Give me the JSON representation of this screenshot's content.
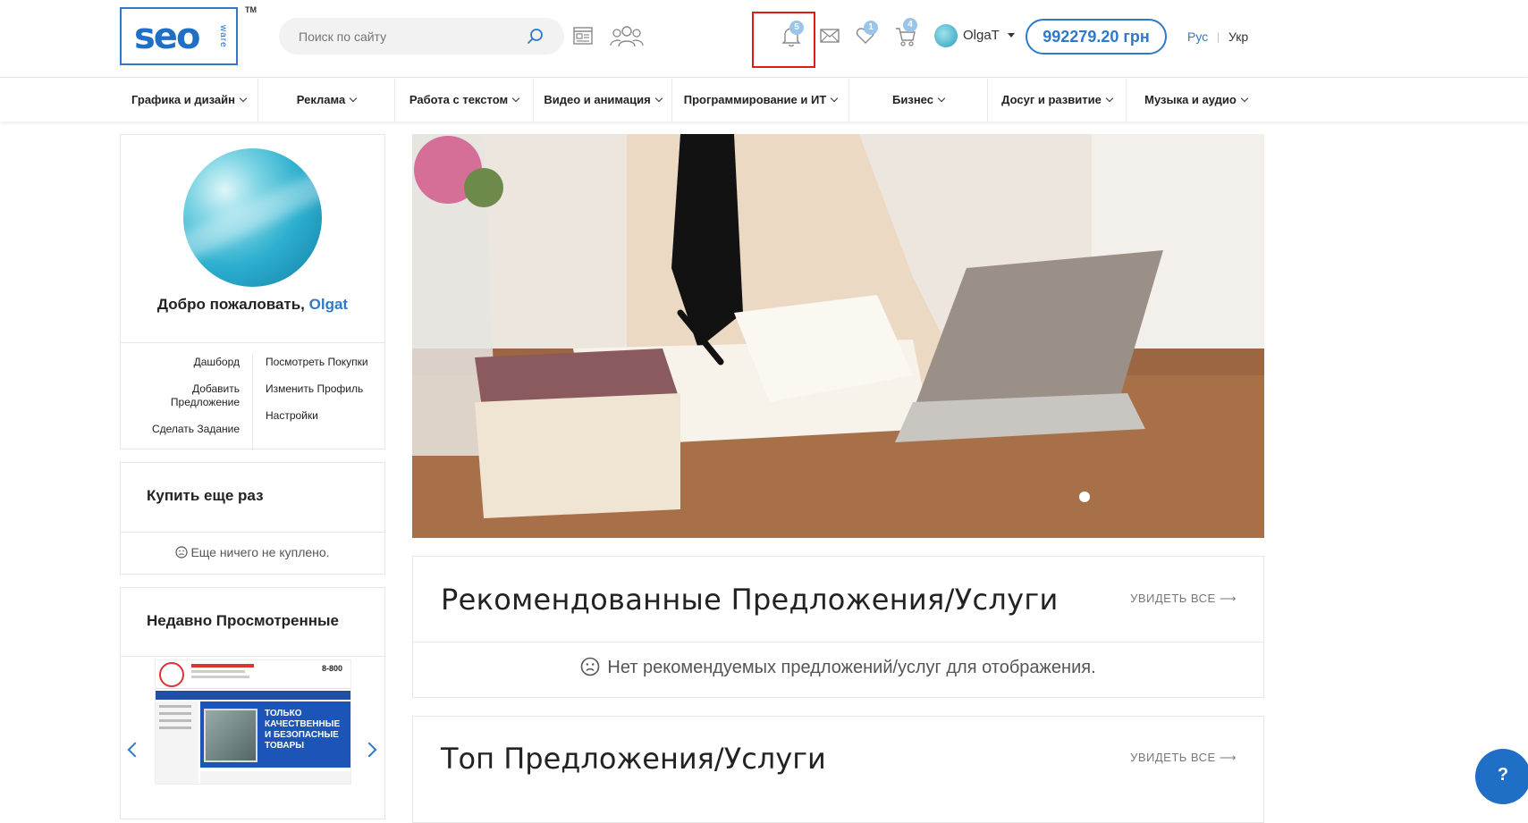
{
  "header": {
    "logo_text": "seo",
    "logo_sub": "ware",
    "logo_tm": "TM",
    "search_placeholder": "Поиск по сайту",
    "notifications_count": "5",
    "favorites_count": "1",
    "cart_count": "4",
    "username": "OlgaT",
    "balance": "992279.20 грн",
    "lang_ru": "Рус",
    "lang_sep": "|",
    "lang_uk": "Укр"
  },
  "nav": {
    "items": [
      {
        "label": "Графика и дизайн"
      },
      {
        "label": "Реклама"
      },
      {
        "label": "Работа с текстом"
      },
      {
        "label": "Видео и анимация"
      },
      {
        "label": "Программирование и ИТ"
      },
      {
        "label": "Бизнес"
      },
      {
        "label": "Досуг и развитие"
      },
      {
        "label": "Музыка и аудио"
      }
    ]
  },
  "profile": {
    "welcome": "Добро пожаловать, ",
    "username": "Olgat",
    "links_left": [
      "Дашборд",
      "Добавить Предложение",
      "Сделать Задание"
    ],
    "links_right": [
      "Посмотреть Покупки",
      "Изменить Профиль",
      "Настройки"
    ]
  },
  "buy_again": {
    "title": "Купить еще раз",
    "empty": "Еще ничего не куплено."
  },
  "recent": {
    "title": "Недавно Просмотренные",
    "thumb_text": "ТОЛЬКО КАЧЕСТВЕННЫЕ И БЕЗОПАСНЫЕ ТОВАРЫ",
    "thumb_phone": "8-800"
  },
  "recommended": {
    "title": "Рекомендованные Предложения/Услуги",
    "see_all": "УВИДЕТЬ ВСЕ",
    "empty": "Нет рекомендуемых предложений/услуг для отображения."
  },
  "top": {
    "title": "Топ Предложения/Услуги",
    "see_all": "УВИДЕТЬ ВСЕ"
  },
  "help_label": "?",
  "colors": {
    "accent": "#2e79c8",
    "badge": "#9ac4ea",
    "highlight": "#e01919"
  }
}
